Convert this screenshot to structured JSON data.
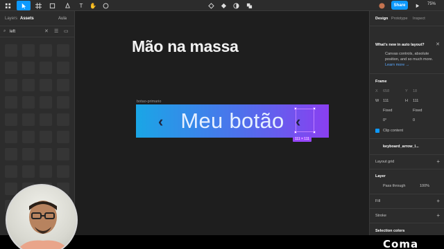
{
  "toolbar": {
    "text_tool": "T",
    "hand_tool": "✋",
    "share_label": "Share",
    "zoom": "75%"
  },
  "left_panel": {
    "tabs": [
      "Layers",
      "Assets"
    ],
    "page": "Aula",
    "search_icon_glyph": "⌕",
    "search_value": "left",
    "clear_glyph": "✕",
    "list_glyph": "☰",
    "library_glyph": "▭",
    "asset_tile_count": 44
  },
  "canvas": {
    "heading": "Mão na massa",
    "frame_name": "botao-primario",
    "button_label": "Meu botão",
    "chevron_glyph": "‹",
    "dimension_badge": "111 × 111"
  },
  "right_panel": {
    "tabs": [
      "Design",
      "Prototype",
      "Inspect"
    ],
    "whats_new": {
      "title": "What's new in auto layout?",
      "close_glyph": "✕",
      "line1": "Canvas controls, absolute",
      "line2": "position, and so much more.",
      "link": "Learn more →"
    },
    "frame": {
      "title": "Frame",
      "x_label": "X",
      "x_value": "658",
      "y_label": "Y",
      "y_value": "18",
      "w_label": "W",
      "w_value": "111",
      "h_label": "H",
      "h_value": "111",
      "width_mode": "Fixed",
      "height_mode": "Fixed",
      "rotation": "0°",
      "radius": "0",
      "clip_content": "Clip content"
    },
    "component_name": "keyboard_arrow_l...",
    "layout_grid": "Layout grid",
    "plus_glyph": "+",
    "layer": {
      "title": "Layer",
      "blend": "Pass through",
      "opacity": "100%"
    },
    "fill": "Fill",
    "stroke": "Stroke",
    "selection_colors": "Selection colors"
  },
  "brand": {
    "logo_text": "Coma"
  },
  "colors": {
    "accent": "#0d99ff",
    "selection": "#9747ff",
    "gradient_start": "#1aa6e6",
    "gradient_end": "#8a3ff0"
  }
}
